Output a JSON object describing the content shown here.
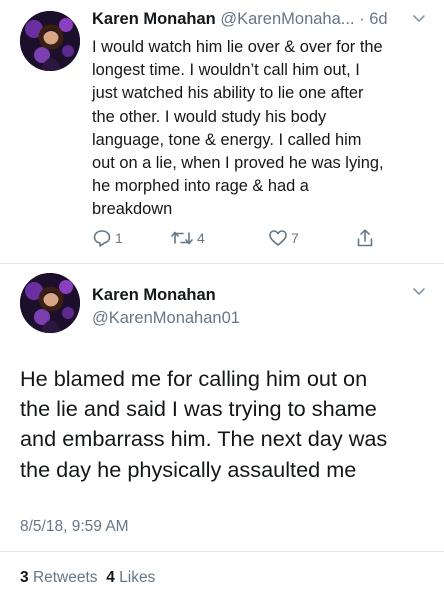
{
  "tweet1": {
    "author_name": "Karen Monahan",
    "author_handle": "@KarenMonaha...",
    "dot": "·",
    "time": "6d",
    "lines": [
      "I would watch him lie over & over for the",
      "longest time. I wouldn’t call him out, I",
      "just watched his ability to lie one after",
      "the other. I would study his body",
      "language, tone & energy. I called him",
      "out on a lie, when I proved he was lying,",
      "he morphed into rage & had a",
      "breakdown"
    ],
    "reply_count": "1",
    "retweet_count": "4",
    "like_count": "7"
  },
  "tweet2": {
    "author_name": "Karen Monahan",
    "author_handle": "@KarenMonahan01",
    "lines": [
      "He blamed me for calling him out on",
      "the lie and said I was trying to shame",
      "and embarrass him. The next day was",
      "the day he physically assaulted me"
    ],
    "timestamp": "8/5/18, 9:59 AM",
    "retweets_count": "3",
    "retweets_label": "Retweets",
    "likes_count": "4",
    "likes_label": "Likes"
  },
  "colors": {
    "text": "#14171a",
    "muted": "#657786",
    "divider": "#e1e8ed",
    "avatar_bg": "#1b0f2b",
    "avatar_accent": "#7b3fb0"
  },
  "icons": [
    "avatar-photo",
    "chevron-down-icon",
    "reply-icon",
    "retweet-icon",
    "heart-icon",
    "share-icon"
  ]
}
